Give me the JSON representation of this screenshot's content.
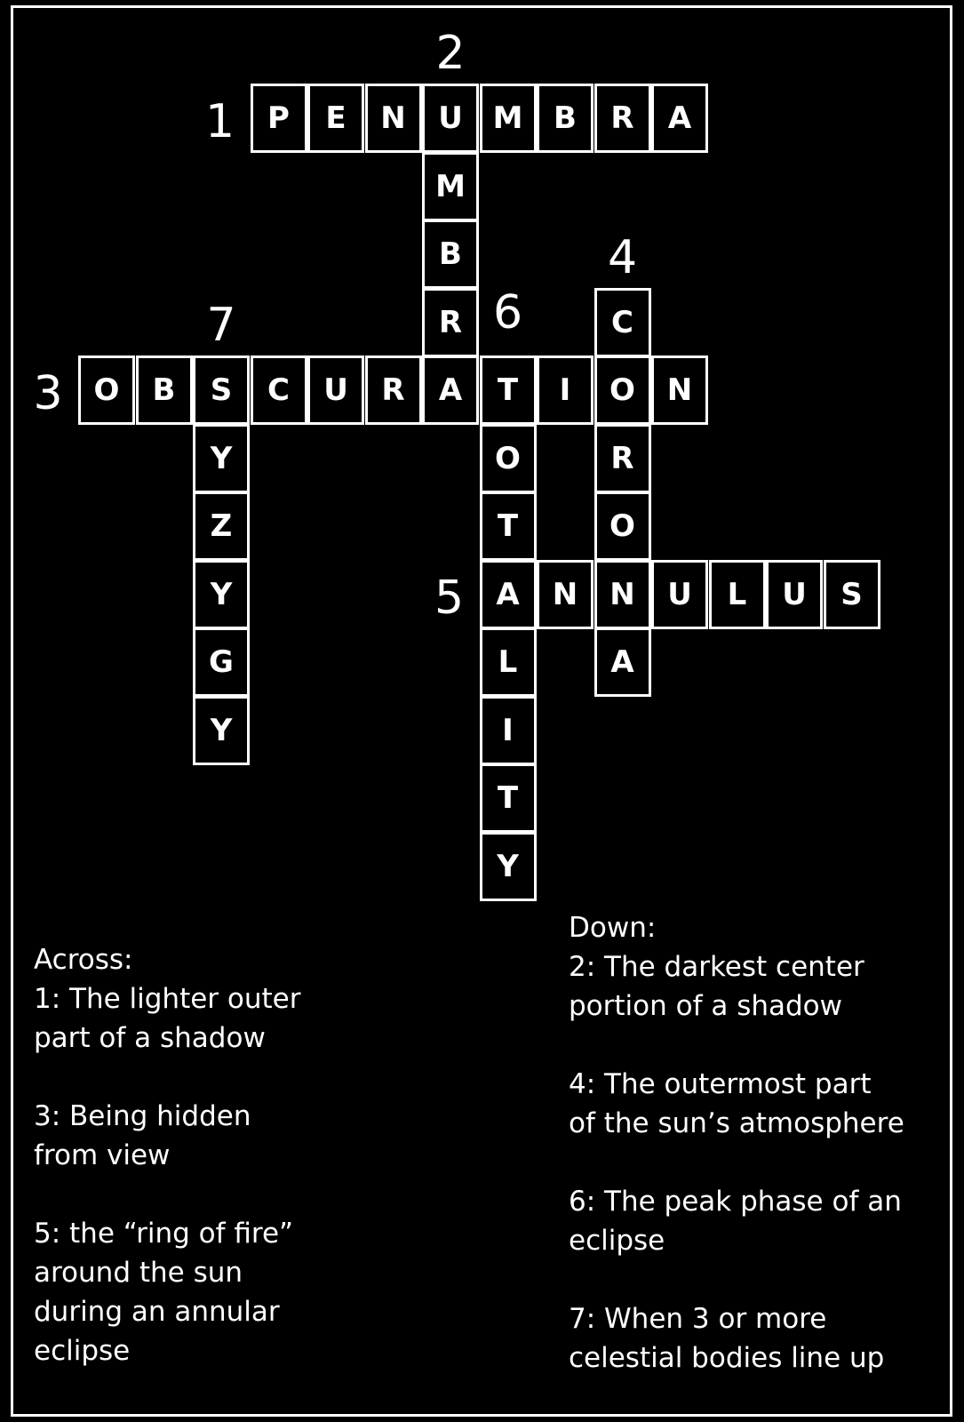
{
  "puzzle": {
    "words": [
      {
        "number": "1",
        "direction": "across",
        "answer": "PENUMBRA",
        "row": 0,
        "col": 3
      },
      {
        "number": "2",
        "direction": "down",
        "answer": "UMBRA",
        "row": 0,
        "col": 6
      },
      {
        "number": "3",
        "direction": "across",
        "answer": "OBSCURATION",
        "row": 4,
        "col": 0
      },
      {
        "number": "4",
        "direction": "down",
        "answer": "CORONA",
        "row": 3,
        "col": 9
      },
      {
        "number": "5",
        "direction": "across",
        "answer": "ANNULUS",
        "row": 7,
        "col": 7
      },
      {
        "number": "6",
        "direction": "down",
        "answer": "TOTALITY",
        "row": 4,
        "col": 7
      },
      {
        "number": "7",
        "direction": "down",
        "answer": "SYZYGY",
        "row": 4,
        "col": 2
      }
    ]
  },
  "across": {
    "heading": "Across:",
    "clues": [
      "1: The lighter outer\npart of a shadow",
      "3: Being hidden\nfrom view",
      "5: the “ring of fire”\naround the sun\nduring an annular\neclipse"
    ]
  },
  "down": {
    "heading": "Down:",
    "clues": [
      "2: The darkest center\nportion of a shadow",
      "4: The outermost part\nof the sun’s atmosphere",
      "6: The peak phase of an\neclipse",
      "7: When 3 or more\ncelestial bodies line up"
    ]
  },
  "colors": {
    "background": "#000000",
    "foreground": "#ffffff"
  }
}
